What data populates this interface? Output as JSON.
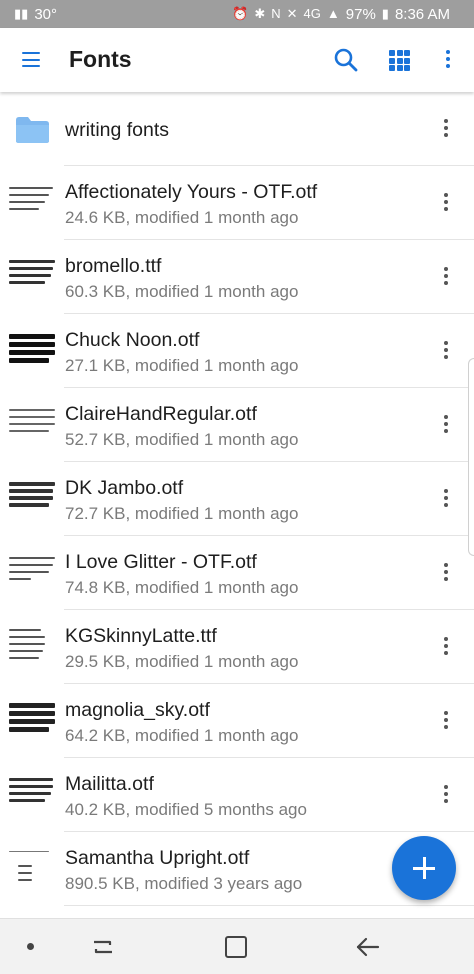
{
  "status_bar": {
    "temperature": "30°",
    "network": "4G",
    "battery": "97%",
    "time": "8:36 AM"
  },
  "app_bar": {
    "title": "Fonts",
    "icons": [
      "menu-icon",
      "search-icon",
      "grid-view-icon",
      "more-vert-icon"
    ]
  },
  "accent_color": "#1a73d9",
  "folder": {
    "name": "writing fonts",
    "icon": "folder-icon",
    "icon_color": "#7fb8ef"
  },
  "files": [
    {
      "name": "Affectionately Yours - OTF.otf",
      "meta": "24.6 KB, modified 1 month ago"
    },
    {
      "name": "bromello.ttf",
      "meta": "60.3 KB, modified 1 month ago"
    },
    {
      "name": "Chuck Noon.otf",
      "meta": "27.1 KB, modified 1 month ago"
    },
    {
      "name": "ClaireHandRegular.otf",
      "meta": "52.7 KB, modified 1 month ago"
    },
    {
      "name": "DK Jambo.otf",
      "meta": "72.7 KB, modified 1 month ago"
    },
    {
      "name": "I Love Glitter - OTF.otf",
      "meta": "74.8 KB, modified 1 month ago"
    },
    {
      "name": "KGSkinnyLatte.ttf",
      "meta": "29.5 KB, modified 1 month ago"
    },
    {
      "name": "magnolia_sky.otf",
      "meta": "64.2 KB, modified 1 month ago"
    },
    {
      "name": "Mailitta.otf",
      "meta": "40.2 KB, modified 5 months ago"
    },
    {
      "name": "Samantha Upright.otf",
      "meta": "890.5 KB, modified 3 years ago"
    }
  ],
  "fab": {
    "icon": "plus-icon"
  },
  "nav_bar": {
    "icons": [
      "nav-dot-icon",
      "recents-icon",
      "home-icon",
      "back-icon"
    ]
  }
}
